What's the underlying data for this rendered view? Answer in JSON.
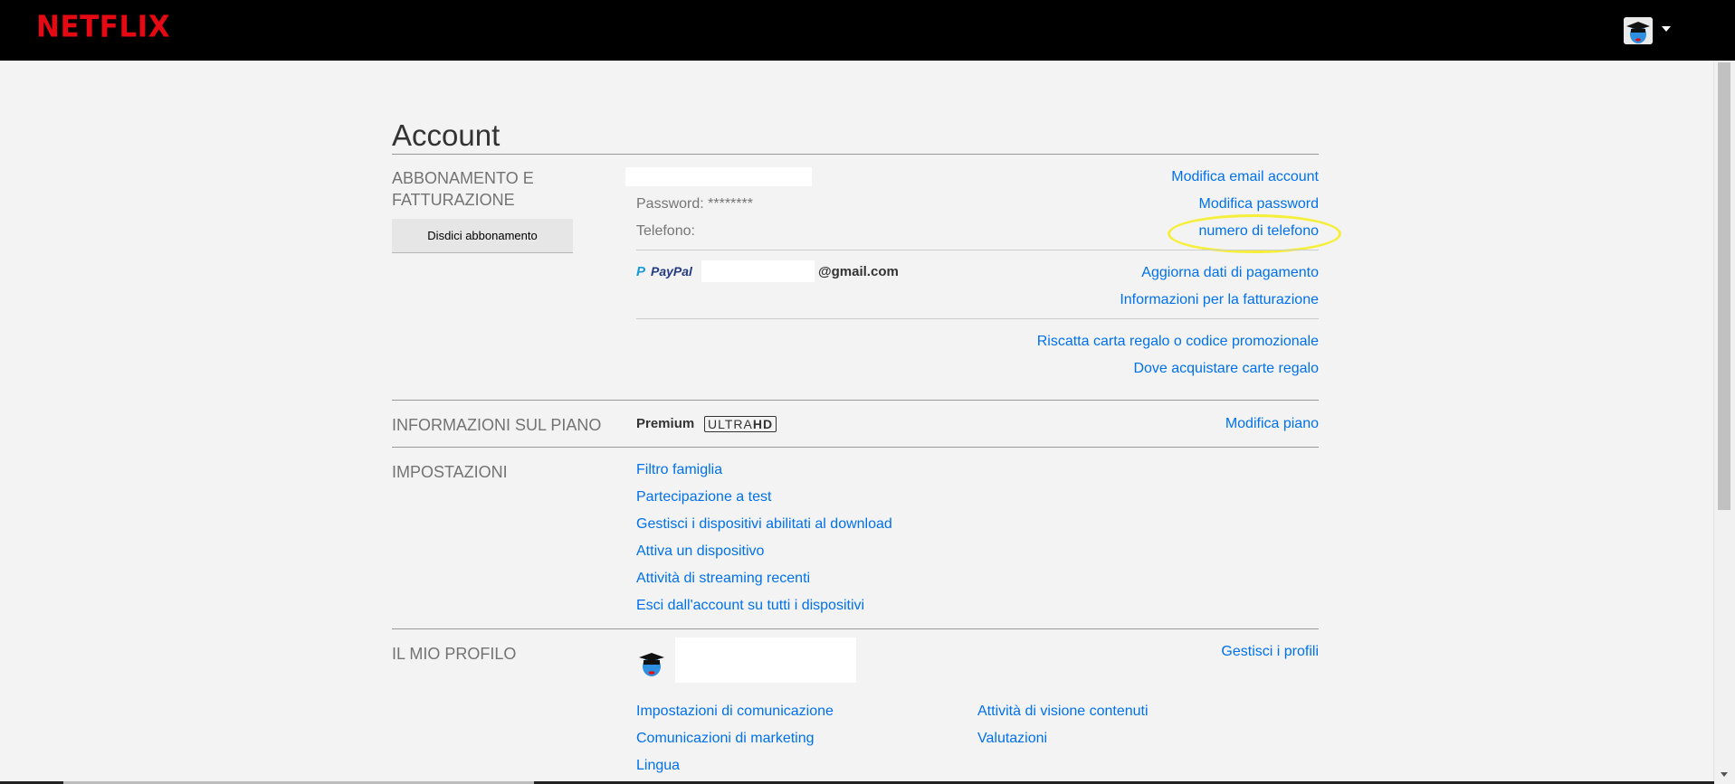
{
  "header": {
    "logo": "NETFLIX"
  },
  "account": {
    "title": "Account"
  },
  "membership": {
    "label": "ABBONAMENTO E FATTURAZIONE",
    "label_line1": "ABBONAMENTO E",
    "label_line2": "FATTURAZIONE",
    "cancel_button": "Disdici abbonamento",
    "password_text": "Password: ********",
    "phone_label": "Telefono:",
    "links": {
      "edit_email": "Modifica email account",
      "edit_password": "Modifica password",
      "phone_number": "numero di telefono",
      "update_payment": "Aggiorna dati di pagamento",
      "billing_info": "Informazioni per la fatturazione",
      "redeem_gift": "Riscatta carta regalo o codice promozionale",
      "where_buy_gift": "Dove acquistare carte regalo"
    },
    "payment": {
      "method": "PayPal",
      "email_suffix": "@gmail.com"
    }
  },
  "plan": {
    "label": "INFORMAZIONI SUL PIANO",
    "name": "Premium",
    "badge_text": "ULTRA",
    "badge_bold": "HD",
    "change_plan": "Modifica piano"
  },
  "settings": {
    "label": "IMPOSTAZIONI",
    "items": [
      "Filtro famiglia",
      "Partecipazione a test",
      "Gestisci i dispositivi abilitati al download",
      "Attiva un dispositivo",
      "Attività di streaming recenti",
      "Esci dall'account su tutti i dispositivi"
    ]
  },
  "profile": {
    "label": "IL MIO PROFILO",
    "manage_profiles": "Gestisci i profili",
    "left_links": [
      "Impostazioni di comunicazione",
      "Comunicazioni di marketing",
      "Lingua"
    ],
    "right_links": [
      "Attività di visione contenuti",
      "Valutazioni"
    ]
  },
  "colors": {
    "brand": "#e50914",
    "link": "#0071eb",
    "highlight": "#f5ef3a"
  }
}
